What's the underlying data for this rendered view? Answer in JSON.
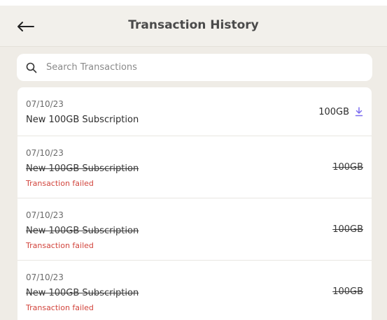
{
  "header": {
    "back_icon": "arrow-left-icon",
    "title": "Transaction History",
    "background": "#f2f0eb"
  },
  "search": {
    "icon": "search-icon",
    "placeholder": "Search Transactions",
    "value": ""
  },
  "transactions": [
    {
      "date": "07/10/23",
      "title": "New 100GB Subscription",
      "amount": "100GB",
      "status": "",
      "failed": false,
      "action_icon": "download-icon",
      "action_color": "#7b6cf0"
    },
    {
      "date": "07/10/23",
      "title": "New 100GB Subscription",
      "amount": "100GB",
      "status": "Transaction failed",
      "failed": true
    },
    {
      "date": "07/10/23",
      "title": "New 100GB Subscription",
      "amount": "100GB",
      "status": "Transaction failed",
      "failed": true
    },
    {
      "date": "07/10/23",
      "title": "New 100GB Subscription",
      "amount": "100GB",
      "status": "Transaction failed",
      "failed": true
    }
  ],
  "colors": {
    "page_background": "#efece6",
    "failed_text": "#d2453d"
  }
}
